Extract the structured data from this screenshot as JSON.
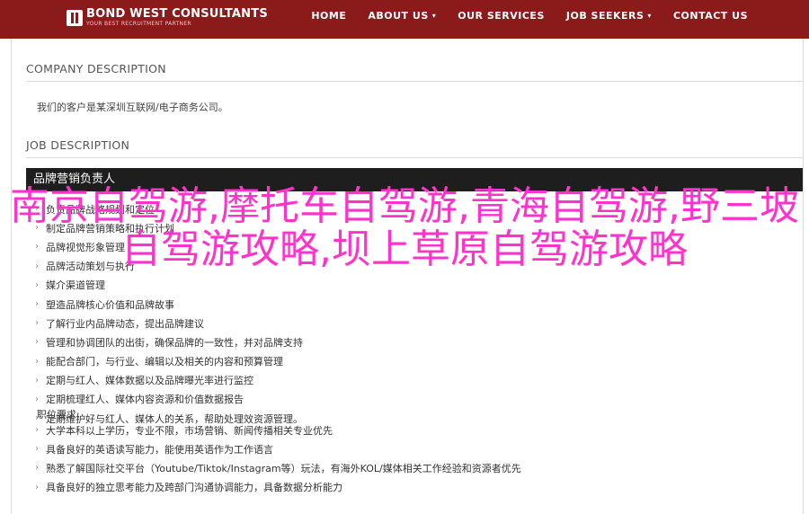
{
  "header": {
    "logo_title": "BOND WEST CONSULTANTS",
    "logo_subtitle": "YOUR BEST RECRUITMENT PARTNER",
    "nav": [
      "HOME",
      "ABOUT US",
      "OUR SERVICES",
      "JOB SEEKERS",
      "CONTACT US"
    ]
  },
  "company": {
    "heading": "COMPANY DESCRIPTION",
    "text": "我们的客户是某深圳互联网/电子商务公司。"
  },
  "job": {
    "heading": "JOB DESCRIPTION",
    "title_bar": "品牌营销负责人",
    "duties": [
      "负责品牌战略规划和定位",
      "制定品牌营销策略和执行计划",
      "品牌视觉形象管理",
      "品牌活动策划与执行",
      "媒介渠道管理",
      "塑造品牌核心价值和品牌故事",
      "了解行业内品牌动态，提出品牌建议",
      "管理和协调团队的出街，确保品牌的一致性，并对品牌支持",
      "能配合部门，与行业、编辑以及相关的内容和预算管理",
      "定期与红人、媒体数据以及品牌曝光率进行监控",
      "定期梳理红人、媒体内容资源和价值数据报告",
      "定期维护好与红人、媒体人的关系，帮助处理效资源管理。"
    ],
    "requirements_heading": "职位要求:",
    "requirements": [
      "大学本科以上学历，专业不限，市场营销、新闻传播相关专业优先",
      "具备良好的英语读写能力，能使用英语作为工作语言",
      "熟悉了解国际社交平台（Youtube/Tiktok/Instagram等）玩法，有海外KOL/媒体相关工作经验和资源者优先",
      "具备良好的独立思考能力及跨部门沟通协调能力，具备数据分析能力"
    ]
  },
  "overlay_title": "南京自驾游,摩托车自驾游,青海自驾游,野三坡自驾游攻略,坝上草原自驾游攻略"
}
